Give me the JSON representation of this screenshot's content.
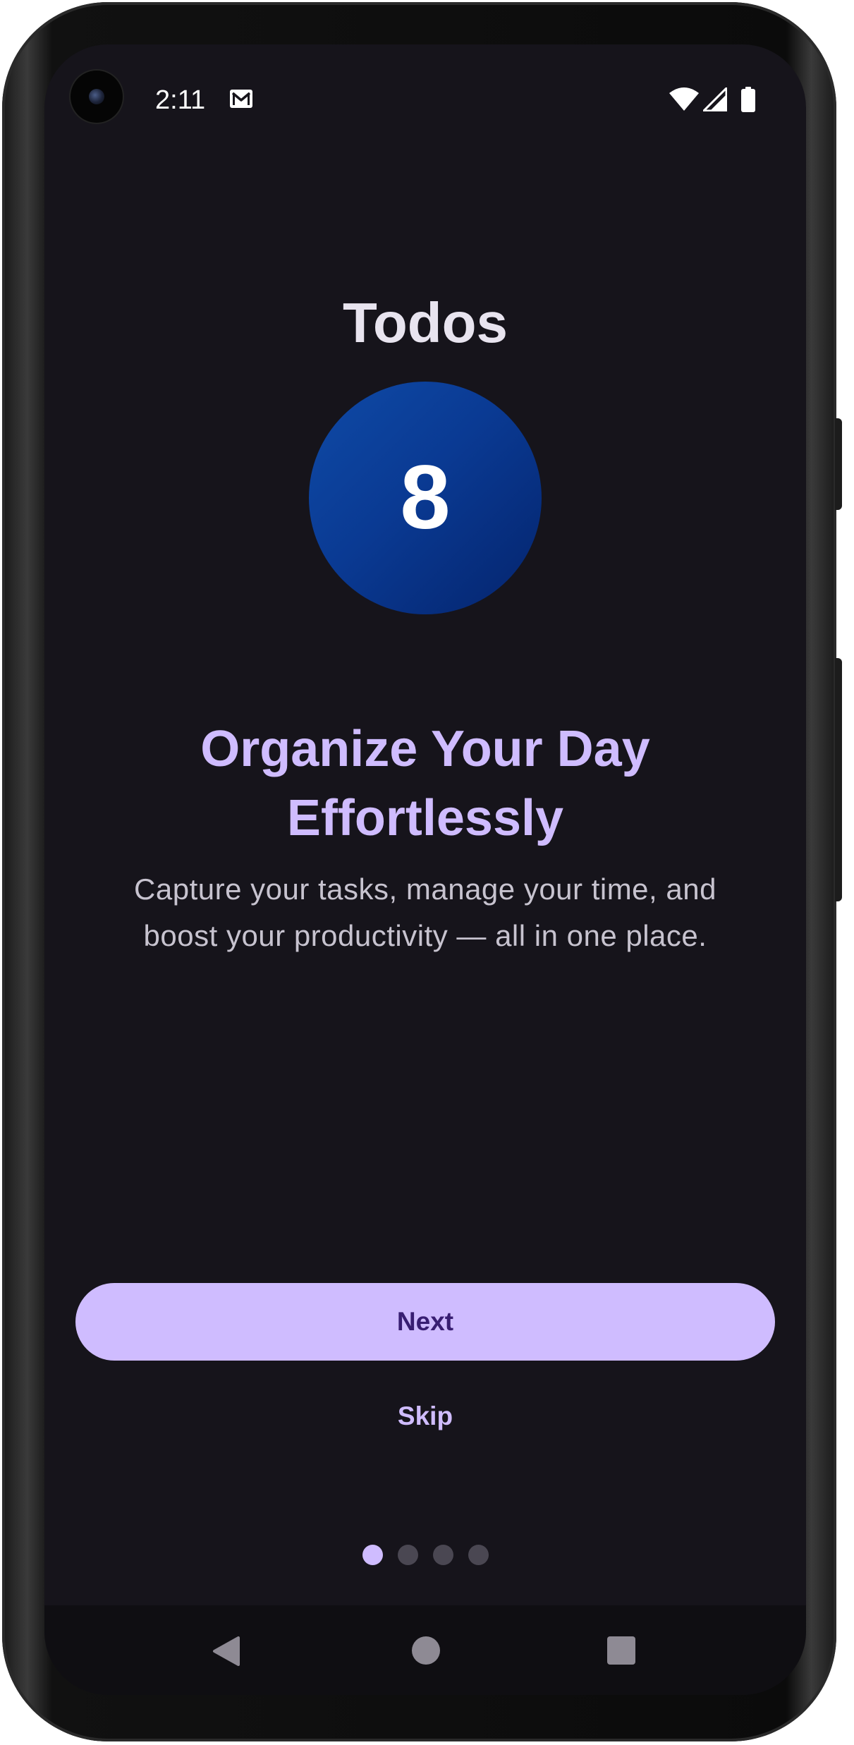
{
  "status_bar": {
    "time": "2:11",
    "icons": [
      "mail-icon",
      "wifi-icon",
      "cellular-signal-icon",
      "battery-icon"
    ]
  },
  "onboarding": {
    "app_title": "Todos",
    "count": "8",
    "headline": "Organize Your Day Effortlessly",
    "description": "Capture your tasks, manage your time, and boost your productivity — all in one place.",
    "next_label": "Next",
    "skip_label": "Skip",
    "pager": {
      "pages": 4,
      "current": 1
    }
  },
  "navigation_bar": {
    "icons": [
      "back-icon",
      "home-icon",
      "recents-icon"
    ]
  },
  "colors": {
    "background": "#16141b",
    "accent": "#cfbcff",
    "on_accent": "#381e72",
    "circle": "#0a3a93",
    "inactive_dot": "#4a4752"
  }
}
